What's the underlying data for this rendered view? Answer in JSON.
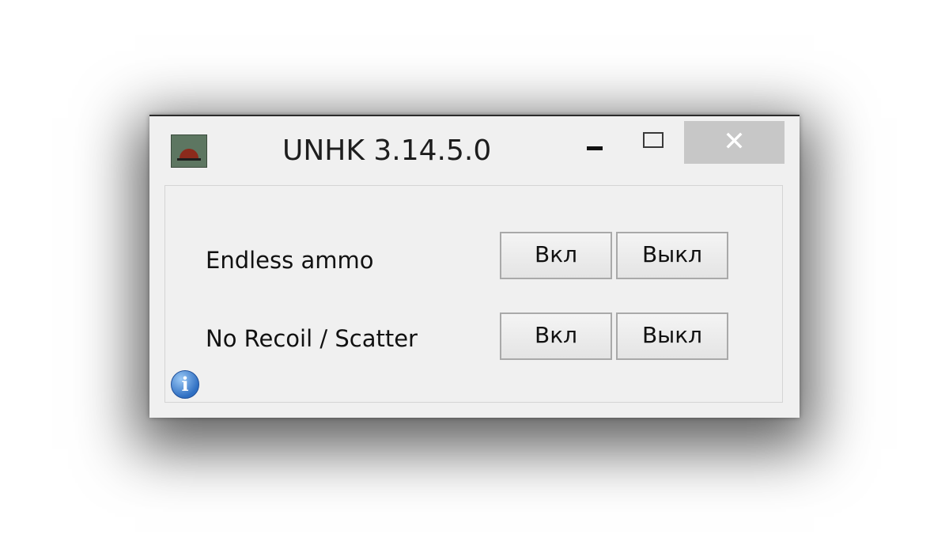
{
  "window": {
    "title": "UNHK 3.14.5.0",
    "app_icon": "car-siren-icon",
    "controls": {
      "minimize_icon": "minimize-icon",
      "maximize_icon": "maximize-icon",
      "close_glyph": "✕"
    }
  },
  "options": [
    {
      "label": "Endless ammo",
      "on_label": "Вкл",
      "off_label": "Выкл"
    },
    {
      "label": "No Recoil / Scatter",
      "on_label": "Вкл",
      "off_label": "Выкл"
    }
  ],
  "info": {
    "icon": "info-icon",
    "glyph": "i"
  },
  "colors": {
    "window_bg": "#f0f0f0",
    "close_button_bg": "#c7c7c7",
    "info_blue": "#2f6fc2"
  }
}
